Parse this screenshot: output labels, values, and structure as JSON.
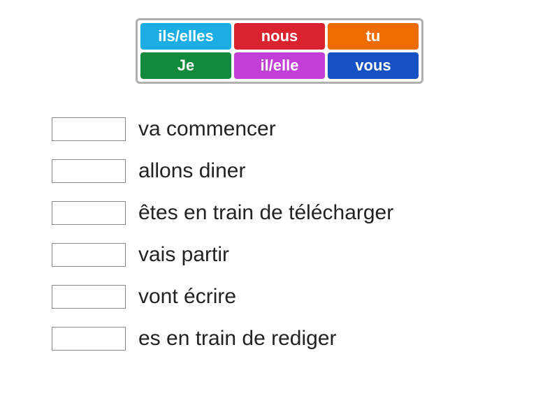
{
  "tiles": {
    "r0c0": "ils/elles",
    "r0c1": "nous",
    "r0c2": "tu",
    "r1c0": "Je",
    "r1c1": "il/elle",
    "r1c2": "vous"
  },
  "phrases": {
    "p0": "va commencer",
    "p1": "allons diner",
    "p2": "êtes en train de télécharger",
    "p3": "vais partir",
    "p4": "vont écrire",
    "p5": "es en train de rediger"
  }
}
